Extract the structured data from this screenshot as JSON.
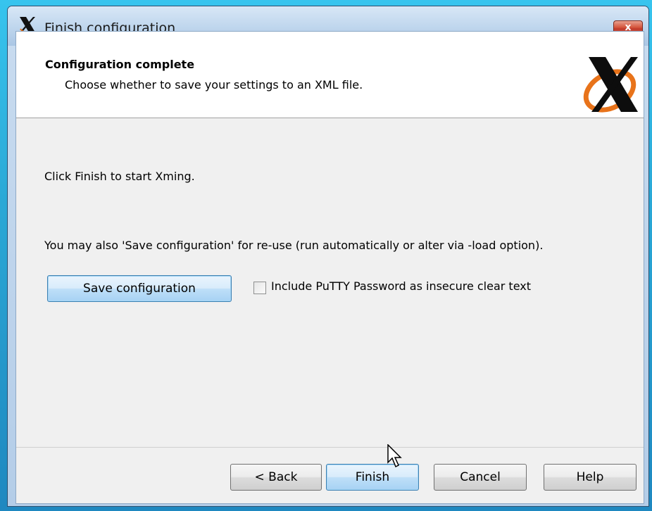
{
  "window": {
    "title": "Finish configuration",
    "close_label": "x"
  },
  "header": {
    "title": "Configuration complete",
    "subtitle": "Choose whether to save your settings to an XML file."
  },
  "body": {
    "start_text": "Click Finish to start Xming.",
    "save_text": "You may also 'Save configuration' for re-use (run automatically or alter via -load option).",
    "save_button_label": "Save configuration",
    "checkbox_label": "Include PuTTY Password as insecure clear text",
    "checkbox_checked": false
  },
  "footer": {
    "back_label": "< Back",
    "finish_label": "Finish",
    "cancel_label": "Cancel",
    "help_label": "Help"
  },
  "icons": {
    "app": "xming-x-icon",
    "logo": "xming-logo-icon",
    "close": "close-icon",
    "cursor": "mouse-pointer-icon"
  },
  "colors": {
    "title_bar": "#bcd4ec",
    "close_button": "#c0392b",
    "focused_button": "#bedff8",
    "logo_orange": "#e8731a"
  }
}
